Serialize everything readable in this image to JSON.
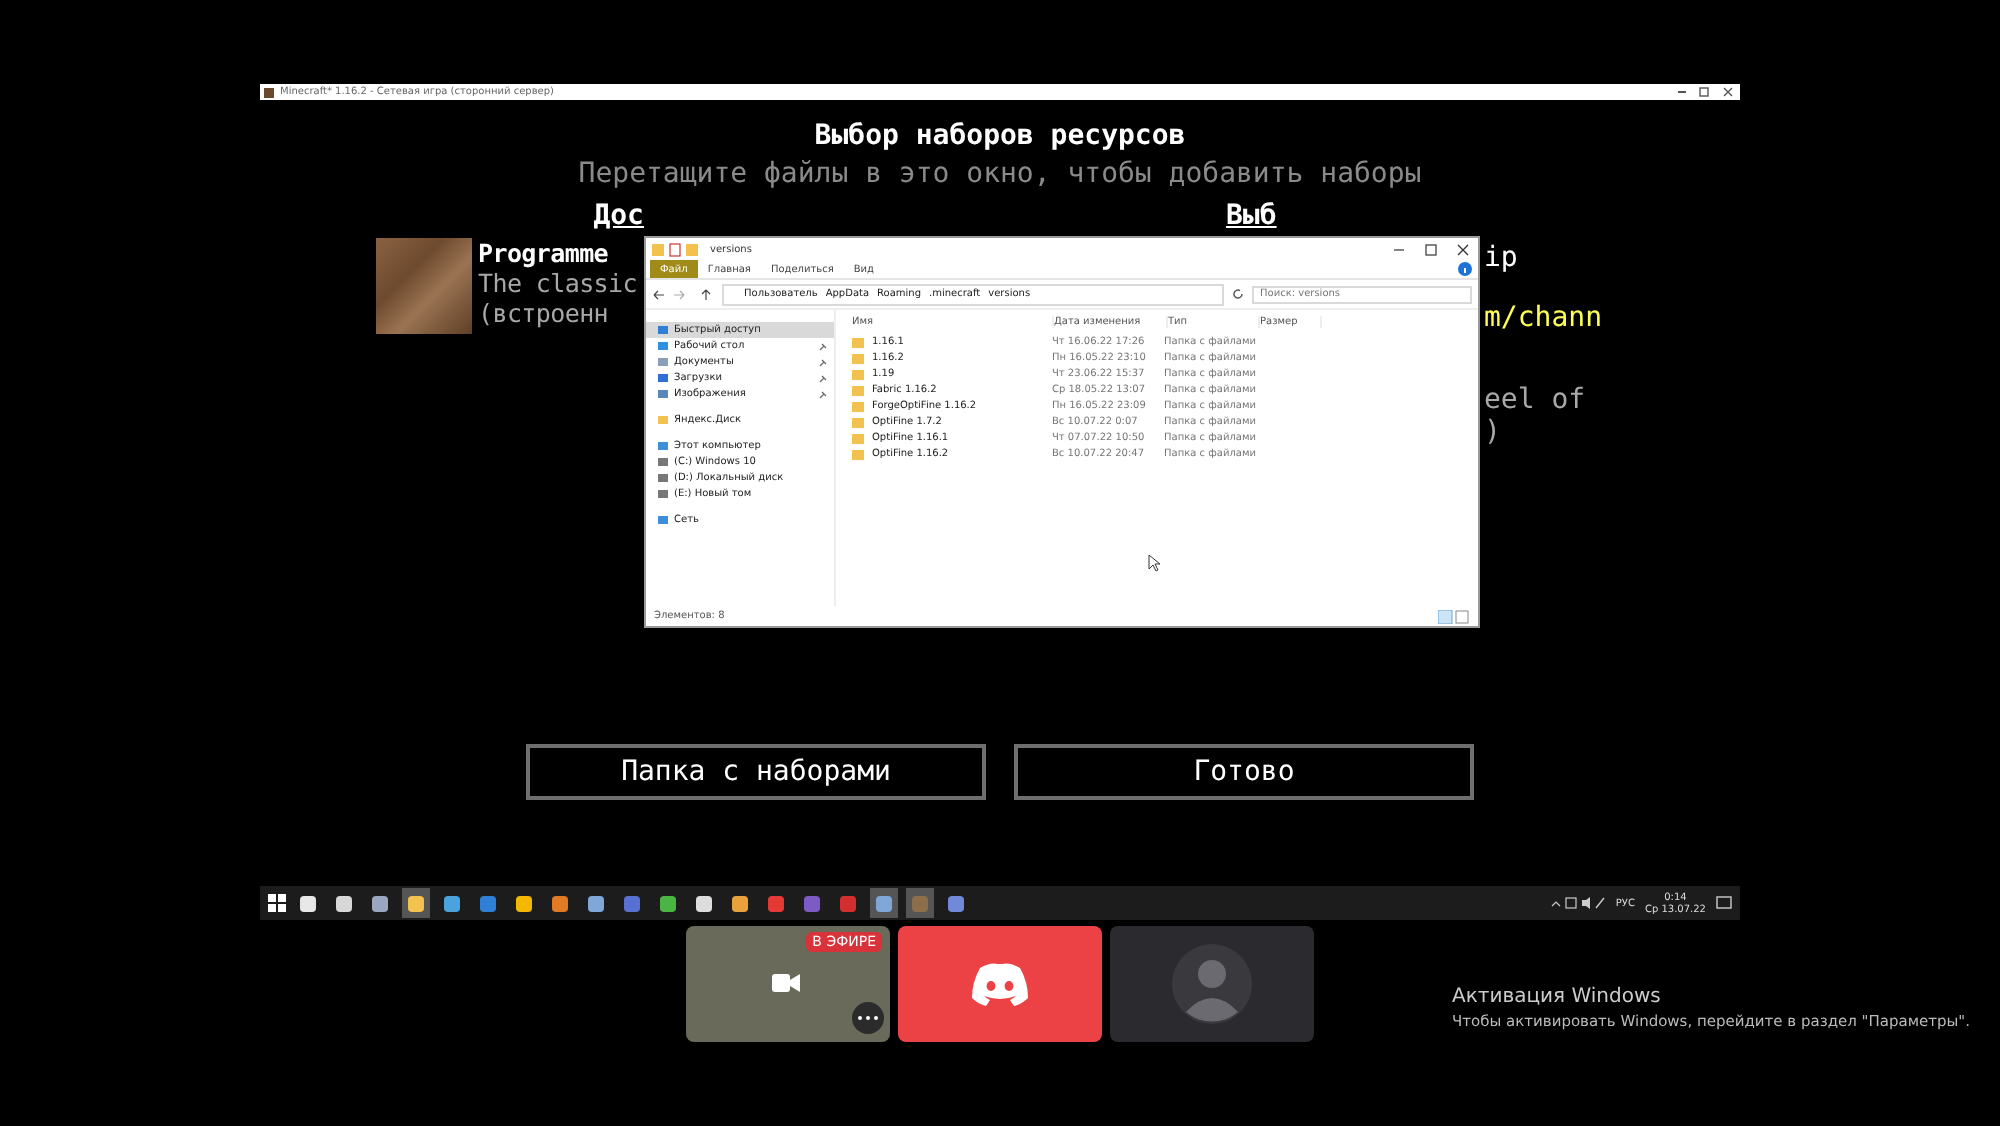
{
  "game_window": {
    "title": "Minecraft* 1.16.2 - Сетевая игра (сторонний сервер)",
    "heading": "Выбор наборов ресурсов",
    "hint": "Перетащите файлы в это окно, чтобы добавить наборы",
    "available_header": "Дос",
    "selected_header": "Выб",
    "pack": {
      "lines": [
        {
          "text": "Programme",
          "color": "#ffffff"
        },
        {
          "text": "The classic",
          "color": "#a8a8a8"
        },
        {
          "text": "(встроенн",
          "color": "#a8a8a8"
        }
      ]
    },
    "right_lines": [
      {
        "text": "ip",
        "color": "#ffffff"
      },
      {
        "text": "m/chann",
        "color": "#ffff55"
      },
      {
        "text": "eel of",
        "color": "#a8a8a8"
      },
      {
        "text": ")",
        "color": "#a8a8a8"
      }
    ],
    "buttons": [
      "Папка с наборами",
      "Готово"
    ]
  },
  "explorer": {
    "title": "versions",
    "ribbon_tabs": [
      {
        "label": "Файл",
        "selected": true
      },
      {
        "label": "Главная",
        "selected": false
      },
      {
        "label": "Поделиться",
        "selected": false
      },
      {
        "label": "Вид",
        "selected": false
      }
    ],
    "path": [
      "Пользователь",
      "AppData",
      "Roaming",
      ".minecraft",
      "versions"
    ],
    "search": {
      "placeholder": "Поиск: versions"
    },
    "nav": [
      {
        "label": "Быстрый доступ",
        "kind": "star",
        "selected": true
      },
      {
        "label": "Рабочий стол",
        "kind": "desktop",
        "selected": false,
        "pinned": true
      },
      {
        "label": "Документы",
        "kind": "doc",
        "selected": false,
        "pinned": true
      },
      {
        "label": "Загрузки",
        "kind": "download",
        "selected": false,
        "pinned": true
      },
      {
        "label": "Изображения",
        "kind": "image",
        "selected": false,
        "pinned": true
      },
      {
        "label": "Яндекс.Диск",
        "kind": "folder",
        "selected": false
      },
      {
        "label": "Этот компьютер",
        "kind": "pc",
        "selected": false
      },
      {
        "label": "(C:) Windows 10",
        "kind": "drive",
        "selected": false
      },
      {
        "label": "(D:) Локальный диск",
        "kind": "drive",
        "selected": false
      },
      {
        "label": "(E:) Новый том",
        "kind": "drive",
        "selected": false
      },
      {
        "label": "Сеть",
        "kind": "network",
        "selected": false
      }
    ],
    "columns": [
      "Имя",
      "Дата изменения",
      "Тип",
      "Размер"
    ],
    "rows": [
      {
        "name": "1.16.1",
        "date": "Чт 16.06.22 17:26",
        "type": "Папка с файлами"
      },
      {
        "name": "1.16.2",
        "date": "Пн 16.05.22 23:10",
        "type": "Папка с файлами"
      },
      {
        "name": "1.19",
        "date": "Чт 23.06.22 15:37",
        "type": "Папка с файлами"
      },
      {
        "name": "Fabric 1.16.2",
        "date": "Ср 18.05.22 13:07",
        "type": "Папка с файлами"
      },
      {
        "name": "ForgeOptiFine 1.16.2",
        "date": "Пн 16.05.22 23:09",
        "type": "Папка с файлами"
      },
      {
        "name": "OptiFine 1.7.2",
        "date": "Вс 10.07.22 0:07",
        "type": "Папка с файлами"
      },
      {
        "name": "OptiFine 1.16.1",
        "date": "Чт 07.07.22 10:50",
        "type": "Папка с файлами"
      },
      {
        "name": "OptiFine 1.16.2",
        "date": "Вс 10.07.22 20:47",
        "type": "Папка с файлами"
      }
    ],
    "status": "Элементов: 8"
  },
  "taskbar": {
    "apps": [
      {
        "color": "#e8e8e8",
        "active": false
      },
      {
        "color": "#d8d8d8",
        "active": false
      },
      {
        "color": "#9aa7c0",
        "active": false
      },
      {
        "color": "#f2c14e",
        "active": true
      },
      {
        "color": "#4aa3df",
        "active": false
      },
      {
        "color": "#2f7fd6",
        "active": false
      },
      {
        "color": "#f5b800",
        "active": false
      },
      {
        "color": "#e07b24",
        "active": false
      },
      {
        "color": "#7fa8d8",
        "active": false
      },
      {
        "color": "#5870d0",
        "active": false
      },
      {
        "color": "#4bb543",
        "active": false
      },
      {
        "color": "#dddddd",
        "active": false
      },
      {
        "color": "#e9a13b",
        "active": false
      },
      {
        "color": "#e53935",
        "active": false
      },
      {
        "color": "#7c5cc4",
        "active": false
      },
      {
        "color": "#d32f2f",
        "active": false
      },
      {
        "color": "#7fa8d8",
        "active": true
      },
      {
        "color": "#8d6e4a",
        "active": true
      },
      {
        "color": "#7289da",
        "active": false
      }
    ],
    "language": "РУС",
    "time": "0:14",
    "date": "Ср 13.07.22"
  },
  "call": {
    "live_badge": "В ЭФИРЕ"
  },
  "activation": {
    "title": "Активация Windows",
    "text": "Чтобы активировать Windows, перейдите в раздел \"Параметры\"."
  }
}
